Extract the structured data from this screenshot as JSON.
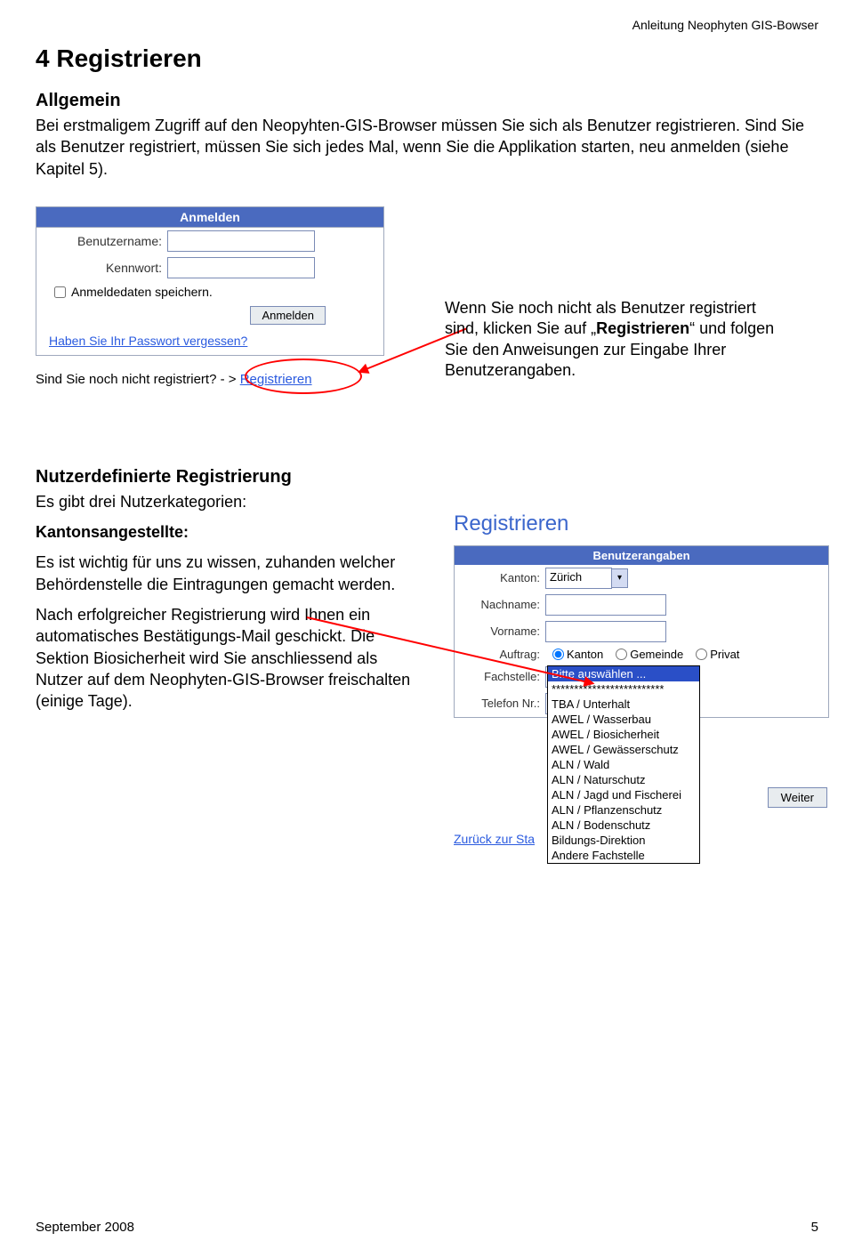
{
  "header_right": "Anleitung Neophyten GIS-Bowser",
  "h1": "4  Registrieren",
  "allgemein": {
    "title": "Allgemein",
    "p1": "Bei erstmaligem Zugriff auf den Neopyhten-GIS-Browser müssen Sie sich als Benutzer registrieren. Sind Sie als Benutzer registriert, müssen Sie sich jedes Mal, wenn Sie die Applikation starten, neu anmelden (siehe Kapitel 5)."
  },
  "login": {
    "title": "Anmelden",
    "username_label": "Benutzername:",
    "password_label": "Kennwort:",
    "remember_label": "Anmeldedaten speichern.",
    "submit": "Anmelden",
    "forgot": "Haben Sie Ihr Passwort vergessen?",
    "noch_nicht": "Sind Sie noch nicht registriert? - >",
    "reg_link": "Registrieren"
  },
  "hint": {
    "pre": "Wenn Sie noch nicht als Benutzer registriert sind, klicken Sie auf „",
    "bold": "Registrieren",
    "post": "“ und folgen Sie den Anweisungen zur Eingabe Ihrer Benutzerangaben."
  },
  "nutzdef": {
    "title": "Nutzerdefinierte Registrierung",
    "p1": "Es gibt drei Nutzerkategorien:",
    "kat_title": "Kantonsangestellte:",
    "p2": "Es ist wichtig für uns zu wissen, zuhanden welcher Behördenstelle die Eintragungen gemacht werden.",
    "p3": "Nach erfolgreicher Registrierung wird Ihnen ein automatisches Bestätigungs-Mail geschickt. Die Sektion Biosicherheit wird Sie anschliessend als Nutzer auf dem Neophyten-GIS-Browser freischalten (einige Tage)."
  },
  "regpanel": {
    "title": "Registrieren",
    "head": "Benutzerangaben",
    "kanton_label": "Kanton:",
    "kanton_value": "Zürich",
    "nachname_label": "Nachname:",
    "vorname_label": "Vorname:",
    "auftrag_label": "Auftrag:",
    "radio1": "Kanton",
    "radio2": "Gemeinde",
    "radio3": "Privat",
    "fachstelle_label": "Fachstelle:",
    "fachstelle_value": "Bitte auswählen ...",
    "telefon_label": "Telefon Nr.:",
    "weiter": "Weiter",
    "back": "Zurück zur Sta",
    "dropdown": {
      "selected": "Bitte auswählen ...",
      "opts": [
        "*************************",
        "TBA / Unterhalt",
        "AWEL / Wasserbau",
        "AWEL / Biosicherheit",
        "AWEL / Gewässerschutz",
        "ALN / Wald",
        "ALN / Naturschutz",
        "ALN / Jagd und Fischerei",
        "ALN / Pflanzenschutz",
        "ALN / Bodenschutz",
        "Bildungs-Direktion",
        "Andere Fachstelle"
      ]
    }
  },
  "footer": {
    "left": "September 2008",
    "right": "5"
  }
}
